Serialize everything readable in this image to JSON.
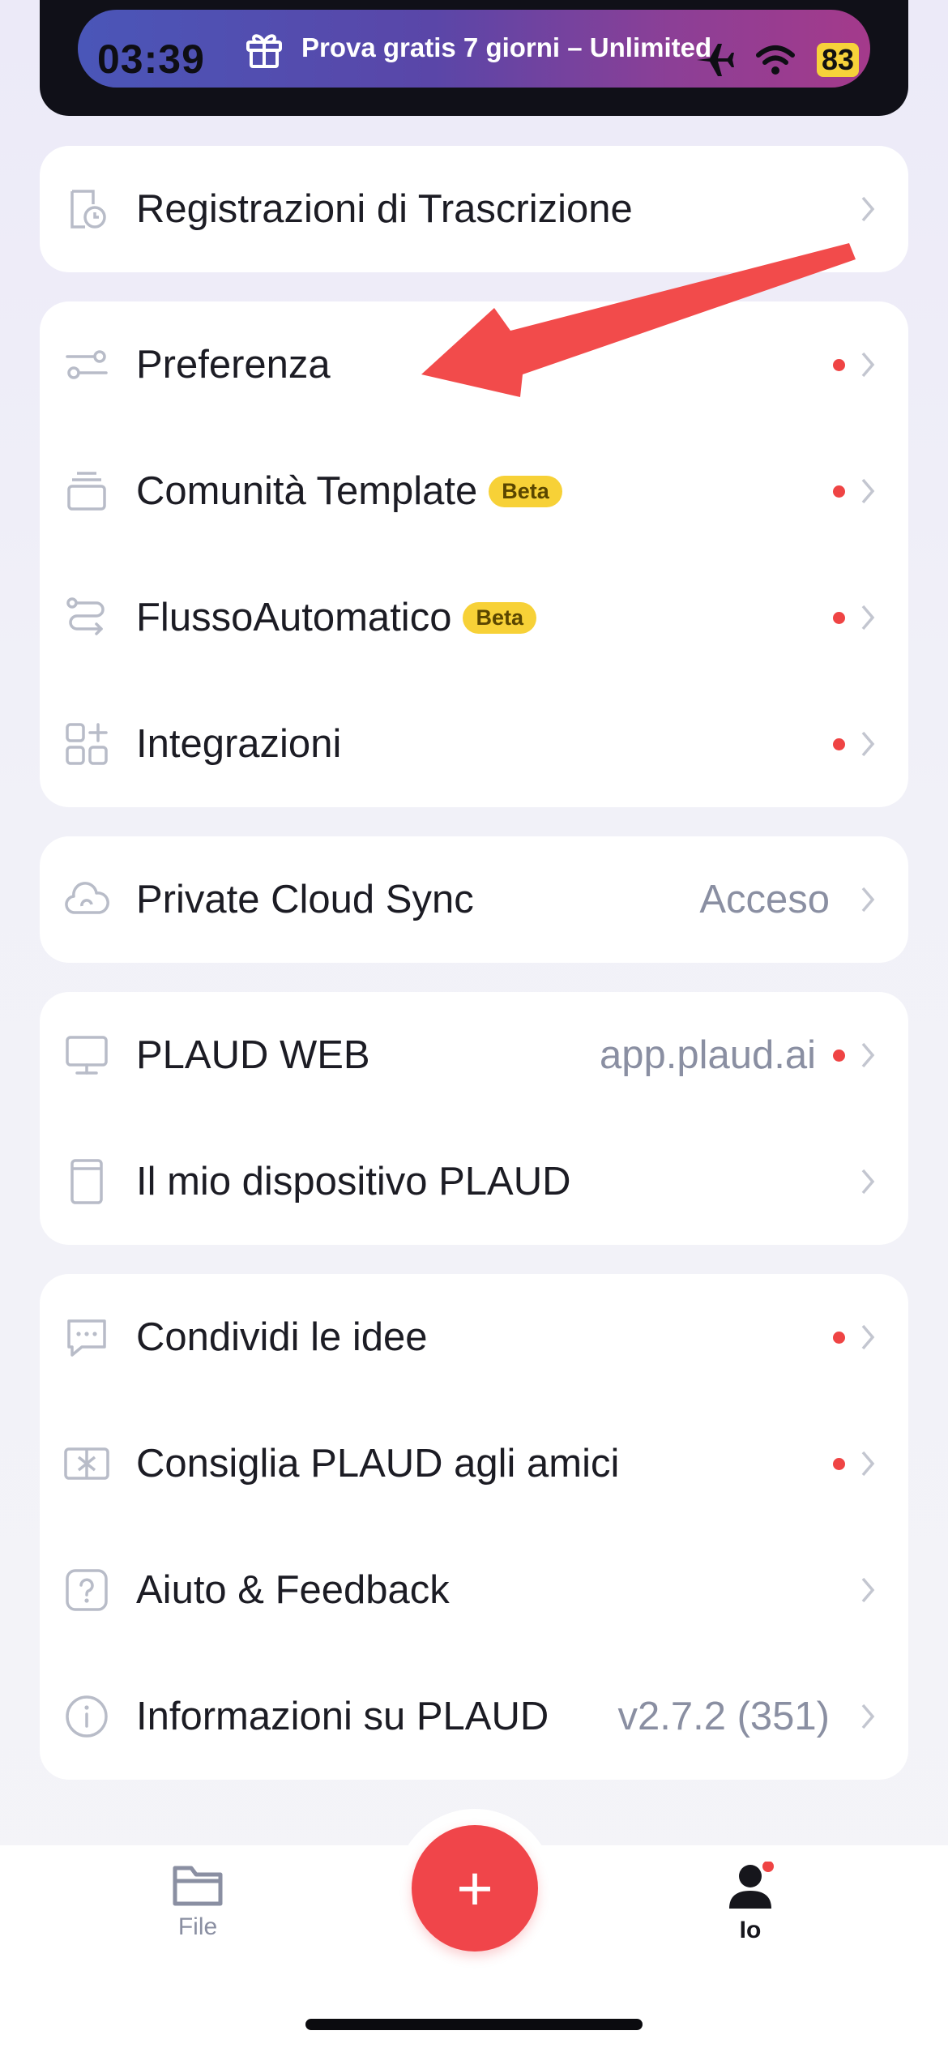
{
  "status_bar": {
    "time": "03:39",
    "battery": "83"
  },
  "promo": {
    "text": "Prova gratis 7 giorni – Unlimited"
  },
  "cards": [
    {
      "rows": [
        {
          "label": "Registrazioni di Trascrizione",
          "icon": "clock-document-icon"
        }
      ]
    },
    {
      "rows": [
        {
          "label": "Preferenza",
          "icon": "sliders-icon",
          "dot": true
        },
        {
          "label": "Comunità Template",
          "badge": "Beta",
          "icon": "stack-icon",
          "dot": true
        },
        {
          "label": "FlussoAutomatico",
          "badge": "Beta",
          "icon": "workflow-icon",
          "dot": true
        },
        {
          "label": "Integrazioni",
          "icon": "apps-add-icon",
          "dot": true
        }
      ]
    },
    {
      "rows": [
        {
          "label": "Private Cloud Sync",
          "value": "Acceso",
          "icon": "cloud-sync-icon"
        }
      ]
    },
    {
      "rows": [
        {
          "label": "PLAUD WEB",
          "value": "app.plaud.ai",
          "icon": "monitor-icon",
          "dot": true
        },
        {
          "label": "Il mio dispositivo PLAUD",
          "icon": "device-icon"
        }
      ]
    },
    {
      "rows": [
        {
          "label": "Condividi le idee",
          "icon": "chat-bubble-icon",
          "dot": true
        },
        {
          "label": "Consiglia PLAUD agli amici",
          "icon": "gift-card-icon",
          "dot": true
        },
        {
          "label": "Aiuto & Feedback",
          "icon": "question-icon"
        },
        {
          "label": "Informazioni su PLAUD",
          "value": "v2.7.2 (351)",
          "icon": "info-icon"
        }
      ]
    }
  ],
  "tabbar": {
    "file_label": "File",
    "me_label": "Io",
    "fab_symbol": "+"
  },
  "colors": {
    "accent": "#f0454a",
    "badge": "#f7d137",
    "dot": "#ef4444"
  }
}
